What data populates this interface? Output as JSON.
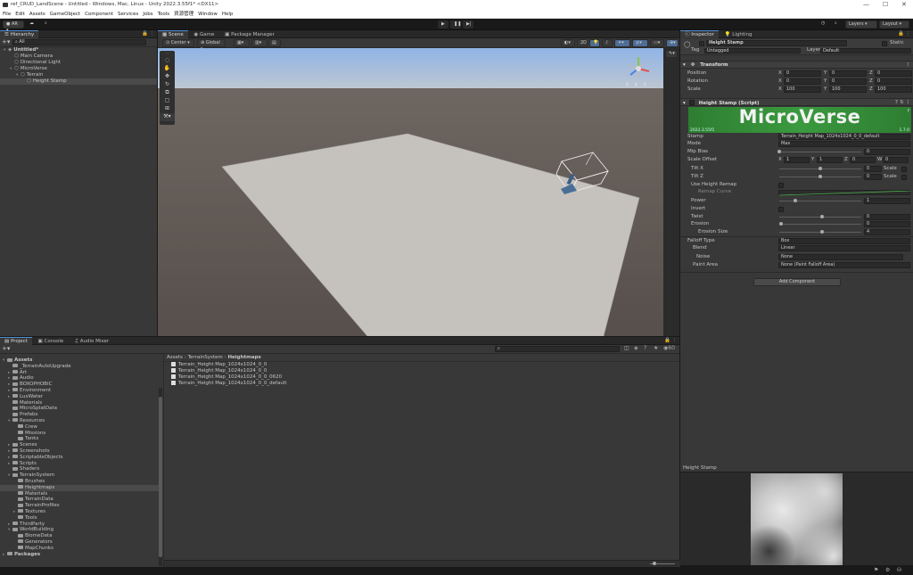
{
  "window": {
    "title": "ref_CRUD_LandScene - Untitled - Windows, Mac, Linux - Unity 2022.3.55f1* <DX11>",
    "controls": [
      "—",
      "☐",
      "✕"
    ]
  },
  "menu": [
    "File",
    "Edit",
    "Assets",
    "GameObject",
    "Component",
    "Services",
    "Jobs",
    "Tools",
    "資源管理",
    "Window",
    "Help"
  ],
  "toolbar": {
    "account": "AR",
    "layers": "Layers",
    "layout": "Layout"
  },
  "hierarchy": {
    "tab": "Hierarchy",
    "search_placeholder": "All",
    "items": [
      {
        "label": "Untitled*",
        "depth": 0
      },
      {
        "label": "Main Camera",
        "depth": 1
      },
      {
        "label": "Directional Light",
        "depth": 1
      },
      {
        "label": "MicroVerse",
        "depth": 1
      },
      {
        "label": "Terrain",
        "depth": 2
      },
      {
        "label": "Height Stamp",
        "depth": 3
      }
    ]
  },
  "scene": {
    "tabs": [
      "Scene",
      "Game",
      "Package Manager"
    ],
    "pivot": "Center",
    "space": "Global",
    "gizmo_labels": [
      "x",
      "y",
      "z"
    ]
  },
  "inspector": {
    "tabs": [
      "Inspector",
      "Lighting"
    ],
    "object_name": "Height Stamp",
    "static_label": "Static",
    "tag_label": "Tag",
    "tag_value": "Untagged",
    "layer_label": "Layer",
    "layer_value": "Default",
    "transform": {
      "title": "Transform",
      "position": {
        "label": "Position",
        "x": "0",
        "y": "0",
        "z": "0"
      },
      "rotation": {
        "label": "Rotation",
        "x": "0",
        "y": "0",
        "z": "0"
      },
      "scale": {
        "label": "Scale",
        "x": "100",
        "y": "100",
        "z": "100"
      }
    },
    "script": {
      "title": "Height Stamp (Script)",
      "banner": "MicroVerse",
      "banner_version_left": "2022.3.55f1",
      "banner_version_right": "1.7.0",
      "stamp_label": "Stamp",
      "stamp_value": "Terrain_Height Map_1024x1024_0_0_default",
      "mode_label": "Mode",
      "mode_value": "Max",
      "mip_label": "Mip Bias",
      "mip_value": "0",
      "offset_label": "Scale Offset",
      "offset": {
        "x": "1",
        "y": "1",
        "z": "0",
        "w": "0"
      },
      "tiltx_label": "Tilt X",
      "tiltx_value": "0",
      "tiltz_label": "Tilt Z",
      "tiltz_value": "0",
      "scale_toggle": "Scale",
      "remap_label": "Use Height Remap",
      "remap_curve_label": "Remap Curve",
      "power_label": "Power",
      "power_value": "1",
      "invert_label": "Invert",
      "twist_label": "Twist",
      "twist_value": "0",
      "erosion_label": "Erosion",
      "erosion_value": "0",
      "erosion_size_label": "Erosion Size",
      "erosion_size_value": "4",
      "falloff_label": "Falloff Type",
      "falloff_value": "Box",
      "blend_label": "Blend",
      "blend_value": "Linear",
      "noise_label": "Noise",
      "noise_value": "None",
      "paint_label": "Paint Area",
      "paint_value": "None (Paint Falloff Area)"
    },
    "add_component": "Add Component"
  },
  "preview": {
    "title": "Height Stamp"
  },
  "project": {
    "tabs": [
      "Project",
      "Console",
      "Audio Mixer"
    ],
    "breadcrumb": [
      "Assets",
      "TerrainSystem",
      "Heightmaps"
    ],
    "hidden_count": "60",
    "tree": [
      {
        "label": "Assets",
        "depth": 0,
        "bold": true
      },
      {
        "label": "_TerrainAutoUpgrade",
        "depth": 1
      },
      {
        "label": "Art",
        "depth": 1
      },
      {
        "label": "Audio",
        "depth": 1
      },
      {
        "label": "BOXOPHOBIC",
        "depth": 1
      },
      {
        "label": "Environment",
        "depth": 1
      },
      {
        "label": "LuxWater",
        "depth": 1
      },
      {
        "label": "Materials",
        "depth": 1
      },
      {
        "label": "MicroSplatData",
        "depth": 1
      },
      {
        "label": "Prefabs",
        "depth": 1
      },
      {
        "label": "Resources",
        "depth": 1
      },
      {
        "label": "Crew",
        "depth": 2
      },
      {
        "label": "Missions",
        "depth": 2
      },
      {
        "label": "Tanks",
        "depth": 2
      },
      {
        "label": "Scenes",
        "depth": 1
      },
      {
        "label": "Screenshots",
        "depth": 1
      },
      {
        "label": "ScriptableObjects",
        "depth": 1
      },
      {
        "label": "Scripts",
        "depth": 1
      },
      {
        "label": "Shaders",
        "depth": 1
      },
      {
        "label": "TerrainSystem",
        "depth": 1
      },
      {
        "label": "Brushes",
        "depth": 2
      },
      {
        "label": "Heightmaps",
        "depth": 2,
        "selected": true
      },
      {
        "label": "Materials",
        "depth": 2
      },
      {
        "label": "TerrainData",
        "depth": 2
      },
      {
        "label": "TerrainProfiles",
        "depth": 2
      },
      {
        "label": "Textures",
        "depth": 2
      },
      {
        "label": "Tools",
        "depth": 2
      },
      {
        "label": "ThirdParty",
        "depth": 1
      },
      {
        "label": "WorldBuilding",
        "depth": 1
      },
      {
        "label": "BiomeData",
        "depth": 2
      },
      {
        "label": "Generators",
        "depth": 2
      },
      {
        "label": "MapChunks",
        "depth": 2
      },
      {
        "label": "Packages",
        "depth": 0,
        "bold": true
      }
    ],
    "files": [
      "Terrain_Height Map_1024x1024_0_0",
      "Terrain_Height Map_1024x1024_0_0",
      "Terrain_Height Map_1024x1024_0_0_0620",
      "Terrain_Height Map_1024x1024_0_0_default"
    ]
  },
  "colors": {
    "accent": "#4d8fd6",
    "banner": "#2e7d32",
    "sky_top": "#8fb4e6",
    "ground": "#5c5450"
  }
}
